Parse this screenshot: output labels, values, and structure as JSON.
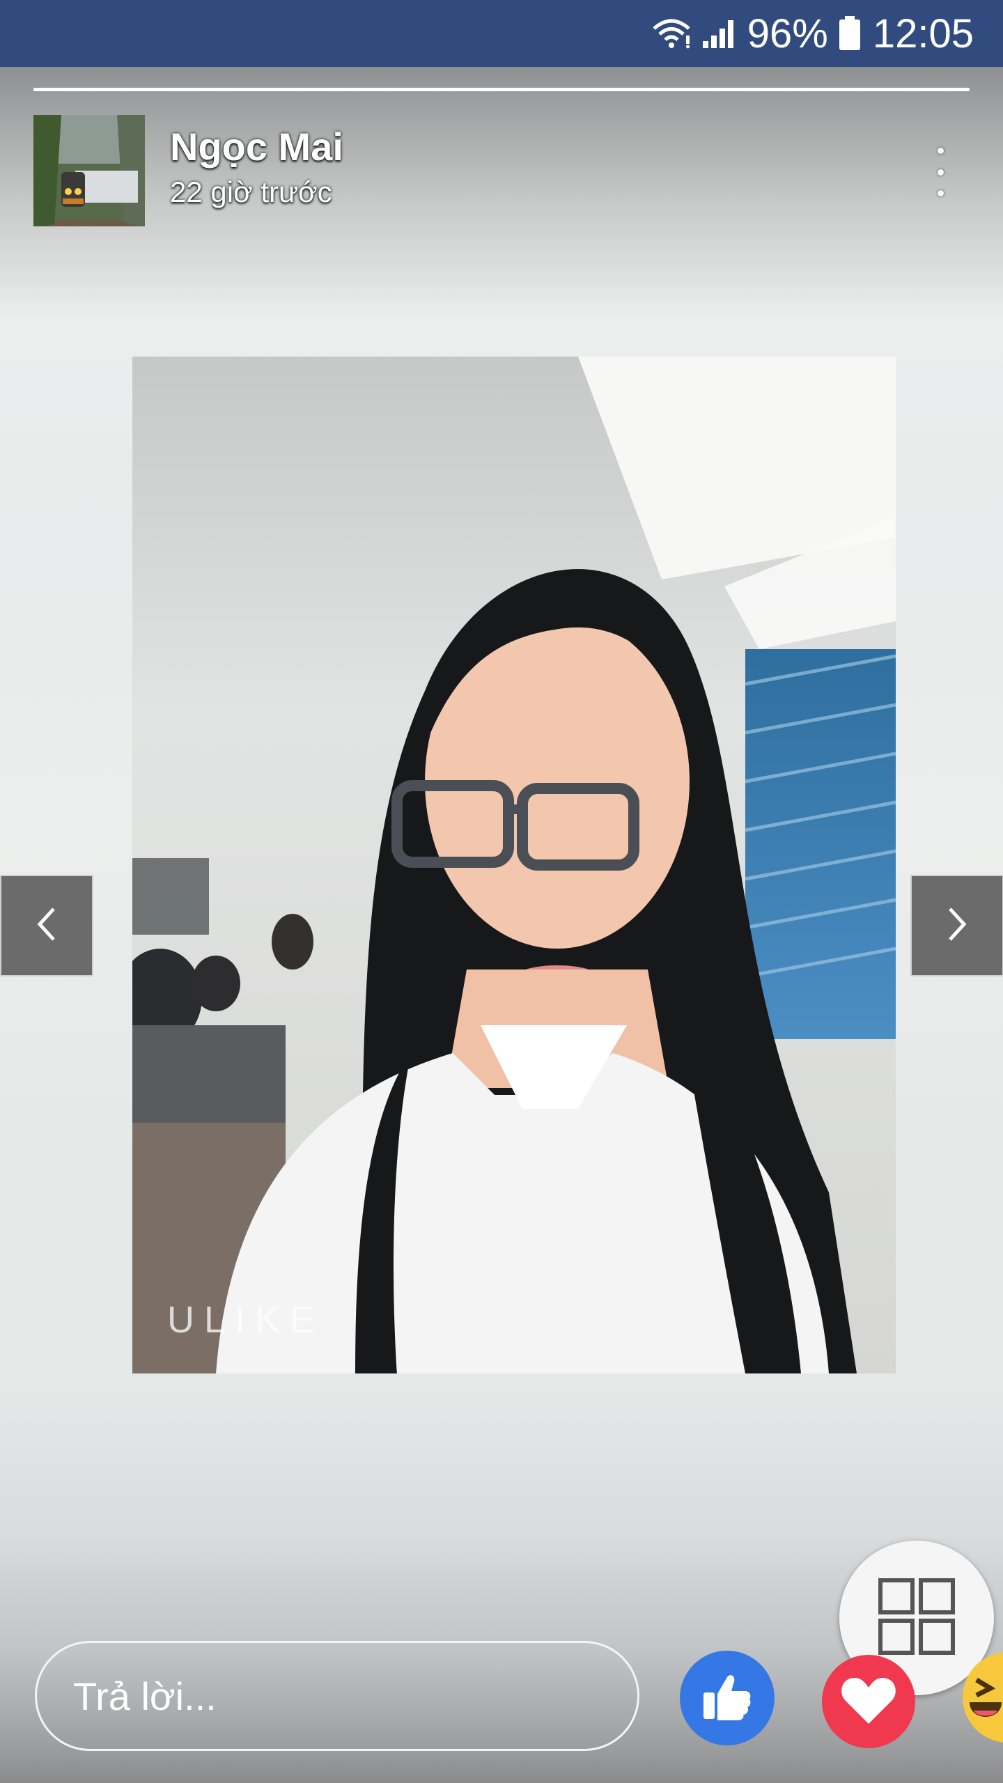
{
  "status_bar": {
    "battery_percent": "96%",
    "time": "12:05",
    "wifi_icon": "wifi-icon",
    "signal_icon": "signal-icon",
    "battery_icon": "battery-icon"
  },
  "story": {
    "progress_fraction": 1.0,
    "author_name": "Ngọc Mai",
    "posted_time": "22 giờ trước",
    "watermark": "ULIKE",
    "more_icon": "more-vertical-icon"
  },
  "navigation": {
    "prev_icon": "chevron-left-icon",
    "next_icon": "chevron-right-icon"
  },
  "reply": {
    "placeholder": "Trả lời..."
  },
  "reactions": [
    {
      "name": "like",
      "icon": "thumbs-up-icon",
      "color": "#3578e5"
    },
    {
      "name": "love",
      "icon": "heart-icon",
      "color": "#f0384f"
    },
    {
      "name": "haha",
      "icon": "laughing-face-icon",
      "color": "#f7c83b"
    }
  ],
  "grid_button": {
    "icon": "grid-icon"
  },
  "colors": {
    "status_bar": "#324b7f",
    "like_blue": "#3578e5",
    "love_red": "#f0384f"
  }
}
